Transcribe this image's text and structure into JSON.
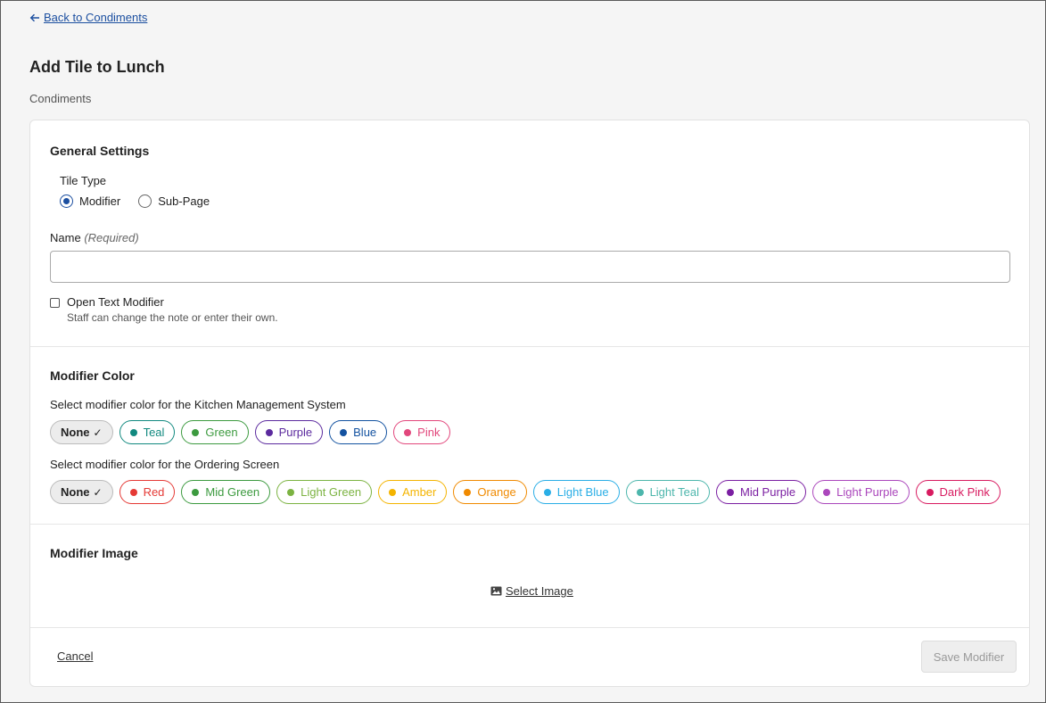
{
  "nav": {
    "back_label": "Back to Condiments"
  },
  "header": {
    "title": "Add Tile to Lunch",
    "subtitle": "Condiments"
  },
  "general": {
    "title": "General Settings",
    "tile_type_label": "Tile Type",
    "tile_types": [
      {
        "label": "Modifier",
        "checked": true
      },
      {
        "label": "Sub-Page",
        "checked": false
      }
    ],
    "name_label": "Name",
    "name_required": "(Required)",
    "name_value": "",
    "open_text_label": "Open Text Modifier",
    "open_text_hint": "Staff can change the note or enter their own.",
    "open_text_checked": false
  },
  "modifier_color": {
    "title": "Modifier Color",
    "kms_label": "Select modifier color for the Kitchen Management System",
    "kms_selected": "None",
    "kms_colors": [
      {
        "label": "Teal",
        "color": "#11897f"
      },
      {
        "label": "Green",
        "color": "#3c9a3f"
      },
      {
        "label": "Purple",
        "color": "#5b2a9e"
      },
      {
        "label": "Blue",
        "color": "#1352a0"
      },
      {
        "label": "Pink",
        "color": "#e2477c"
      }
    ],
    "screen_label": "Select modifier color for the Ordering Screen",
    "screen_selected": "None",
    "screen_colors": [
      {
        "label": "Red",
        "color": "#e53935"
      },
      {
        "label": "Mid Green",
        "color": "#3c9a3f"
      },
      {
        "label": "Light Green",
        "color": "#7cb342"
      },
      {
        "label": "Amber",
        "color": "#f4b400"
      },
      {
        "label": "Orange",
        "color": "#f08a00"
      },
      {
        "label": "Light Blue",
        "color": "#2aaee6"
      },
      {
        "label": "Light Teal",
        "color": "#4db6ac"
      },
      {
        "label": "Mid Purple",
        "color": "#7b1fa2"
      },
      {
        "label": "Light Purple",
        "color": "#ab47bc"
      },
      {
        "label": "Dark Pink",
        "color": "#d81b60"
      }
    ]
  },
  "modifier_image": {
    "title": "Modifier Image",
    "select_label": "Select Image"
  },
  "footer": {
    "cancel_label": "Cancel",
    "save_label": "Save Modifier"
  }
}
